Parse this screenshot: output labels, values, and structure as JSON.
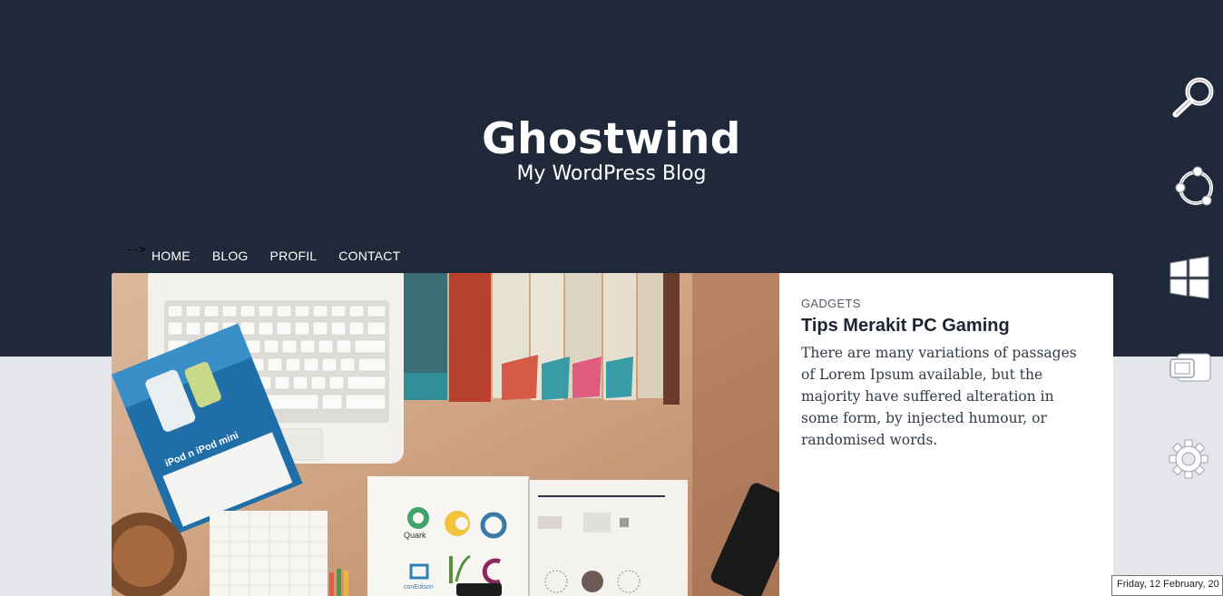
{
  "site": {
    "title": "Ghostwind",
    "tagline": "My WordPress Blog",
    "stray_text": "-->"
  },
  "nav": {
    "items": [
      "HOME",
      "BLOG",
      "PROFIL",
      "CONTACT"
    ]
  },
  "featured_post": {
    "category": "GADGETS",
    "title": "Tips Merakit PC Gaming",
    "excerpt": "There are many variations of passages of Lorem Ipsum available, but the majority have suffered alteration in some form, by injected humour, or randomised words.",
    "image": {
      "ipod_text": "iPod n iPod mini",
      "logo_text_1": "Quark",
      "logo_text_2": "conEdison"
    }
  },
  "charms": [
    "search-icon",
    "share-icon",
    "start-icon",
    "devices-icon",
    "settings-icon"
  ],
  "taskbar": {
    "date": "Friday, 12 February, 20"
  },
  "colors": {
    "header_bg": "#202939",
    "page_bg": "#e5e6e9",
    "card_bg": "#ffffff",
    "title_dark": "#1e2431"
  }
}
